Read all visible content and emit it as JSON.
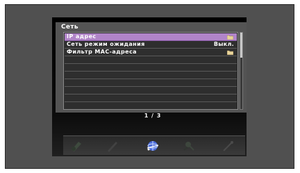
{
  "panel": {
    "title": "Сеть"
  },
  "menu": {
    "items": [
      {
        "label": "IP адрес",
        "value": "",
        "icon": "folder-icon",
        "selected": true
      },
      {
        "label": "Сеть режим ожидания",
        "value": "Выкл.",
        "icon": "",
        "selected": false
      },
      {
        "label": "Фильтр МАС-адреса",
        "value": "",
        "icon": "folder-icon",
        "selected": false
      }
    ]
  },
  "pager": {
    "text": "1 / 3"
  },
  "dock": {
    "items": [
      {
        "icon": "film-icon",
        "active": false
      },
      {
        "icon": "pen-icon",
        "active": false
      },
      {
        "icon": "globe-network-icon",
        "active": true
      },
      {
        "icon": "tools-icon",
        "active": false
      },
      {
        "icon": "wrench-icon",
        "active": false
      }
    ]
  },
  "colors": {
    "selection": "#b084c8",
    "frame": "#505050",
    "panel": "#545454"
  }
}
